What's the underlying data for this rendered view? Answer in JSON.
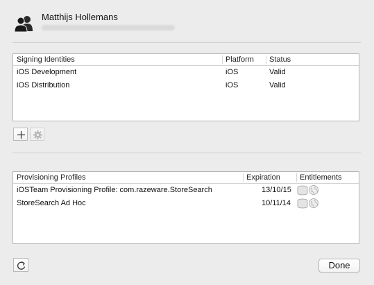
{
  "account": {
    "name": "Matthijs Hollemans",
    "email_redacted": "",
    "icon": "users-icon"
  },
  "signing": {
    "columns": [
      "Signing Identities",
      "Platform",
      "Status"
    ],
    "rows": [
      {
        "name": "iOS Development",
        "platform": "iOS",
        "status": "Valid"
      },
      {
        "name": "iOS Distribution",
        "platform": "iOS",
        "status": "Valid"
      }
    ],
    "add_icon": "plus-icon",
    "settings_icon": "gear-icon"
  },
  "profiles": {
    "columns": [
      "Provisioning Profiles",
      "Expiration",
      "Entitlements"
    ],
    "rows": [
      {
        "name": "iOSTeam Provisioning Profile: com.razeware.StoreSearch",
        "expiration": "13/10/15",
        "entitlements_icon": "entitlements-icon"
      },
      {
        "name": "StoreSearch Ad Hoc",
        "expiration": "10/11/14",
        "entitlements_icon": "entitlements-icon"
      }
    ],
    "refresh_icon": "refresh-icon"
  },
  "footer": {
    "done_label": "Done"
  }
}
